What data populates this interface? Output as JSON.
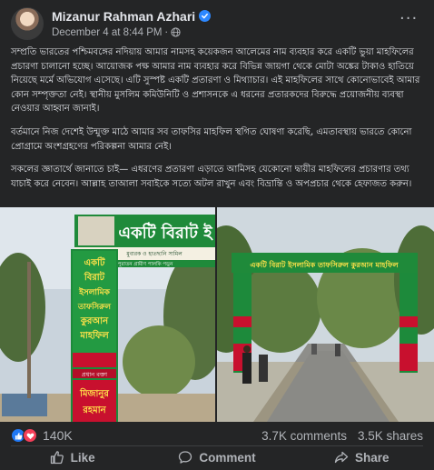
{
  "post": {
    "author": "Mizanur Rahman Azhari",
    "timestamp": "December 4 at 8:44 PM",
    "more_label": "···",
    "paragraphs": [
      "সম্প্রতি ভারতের পশ্চিমবঙ্গের নদিয়ায় আমার নামসহ কয়েকজন আলেমের নাম ব্যবহার করে একটি ভুয়া মাহফিলের প্রচারণা চালানো হচ্ছে। আয়োজক পক্ষ আমার নাম ব্যবহার করে বিভিন্ন জায়গা থেকে মোটা অঙ্কের টাকাও হাতিয়ে নিয়েছে মর্মে অভিযোগ এসেছে। এটি সুস্পষ্ট একটি প্রতারণা ও মিথ্যাচার। এই মাহফিলের সাথে কোনোভাবেই আমার কোন সম্পৃক্ততা নেই। স্থানীয় মুসলিম কমিউনিটি ও প্রশাসনকে এ ধরনের প্রতারকদের বিরুদ্ধে প্রয়োজনীয় ব্যবস্থা নেওয়ার আহ্বান জানাই।",
      "বর্তমানে নিজ দেশেই উন্মুক্ত মাঠে আমার সব তাফসির মাহফিল স্থগিত ঘোষণা করেছি, এমতাবস্থায় ভারতে কোনো প্রোগ্রামে অংশগ্রহণের পরিকল্পনা আমার নেই।",
      "সকলের জ্ঞাতার্থে জানাতে চাই— এধরণের প্রতারণা এড়াতে আমিসহ যেকোনো দ্বায়ীর মাহফিলের প্রচারণার তথ্য যাচাই করে নেবেন। আল্লাহ তাআলা সবাইকে সত্যে অটল রাখুন এবং বিভ্রান্তি ও অপপ্রচার থেকে হেফাজত করুন।"
    ]
  },
  "photos": {
    "left": {
      "banner_top": "একটি বিরাট ই",
      "banner_sub": "মুবারক ও হাতছানি সামিল",
      "banner_sub2": "পুরাতন গ্রামীণ পালকি পড়ুন",
      "vertical_lines": [
        "একটি",
        "বিরাট",
        "ইসলামিক",
        "তাফসিরুল",
        "কুরআন",
        "মাহফিল"
      ],
      "guest_label": "প্রধান বক্তা",
      "guest_name_1": "মিজানুর",
      "guest_name_2": "রহমান"
    },
    "right": {
      "banner_top": "একটি বিরাট ইসলামিক তাফসিরুল কুরআন মাহফিল"
    }
  },
  "stats": {
    "reactions": "140K",
    "comments": "3.7K comments",
    "shares": "3.5K shares"
  },
  "actions": {
    "like": "Like",
    "comment": "Comment",
    "share": "Share"
  },
  "colors": {
    "background": "#242526",
    "text": "#e4e6eb",
    "secondary": "#b0b3b8",
    "verified": "#2d88ff",
    "like": "#2078f4",
    "love": "#f33e58"
  }
}
